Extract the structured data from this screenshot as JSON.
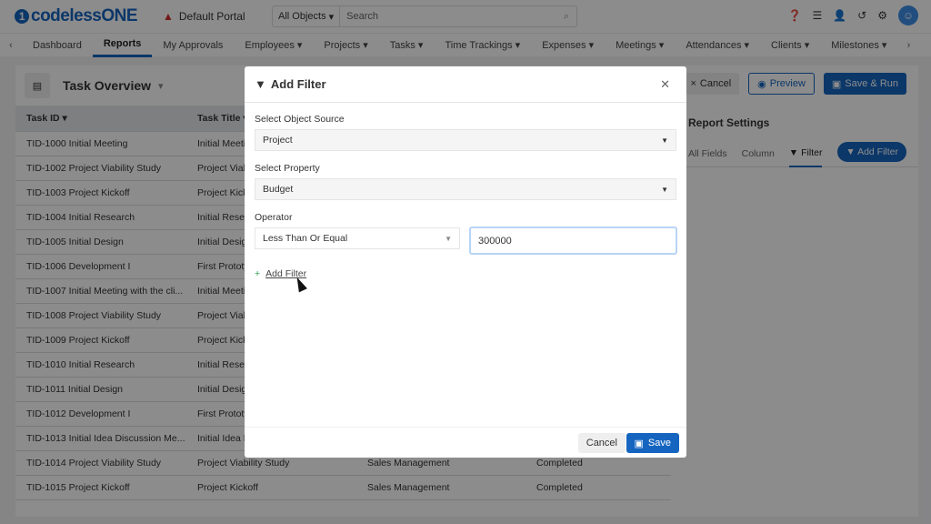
{
  "app": {
    "logo": "codelessONE",
    "portal": "Default Portal",
    "search_scope": "All Objects",
    "search_placeholder": "Search"
  },
  "nav": [
    "Dashboard",
    "Reports",
    "My Approvals",
    "Employees ▾",
    "Projects ▾",
    "Tasks ▾",
    "Time Trackings ▾",
    "Expenses ▾",
    "Meetings ▾",
    "Attendances ▾",
    "Clients ▾",
    "Milestones ▾"
  ],
  "report": {
    "title": "Task Overview",
    "cancel": "Cancel",
    "preview": "Preview",
    "save_run": "Save & Run"
  },
  "table": {
    "headers": [
      "Task ID ▾",
      "Task Title ▾",
      "",
      ""
    ],
    "rows": [
      [
        "TID-1000 Initial Meeting",
        "Initial Meeting",
        "",
        ""
      ],
      [
        "TID-1002 Project Viability Study",
        "Project Viability Study",
        "",
        ""
      ],
      [
        "TID-1003 Project Kickoff",
        "Project Kickoff",
        "",
        ""
      ],
      [
        "TID-1004 Initial Research",
        "Initial Research",
        "",
        ""
      ],
      [
        "TID-1005 Initial Design",
        "Initial Design",
        "",
        ""
      ],
      [
        "TID-1006 Development I",
        "First Prototype",
        "",
        ""
      ],
      [
        "TID-1007 Initial Meeting with the cli...",
        "Initial Meeting",
        "",
        ""
      ],
      [
        "TID-1008 Project Viability Study",
        "Project Viability Study",
        "",
        ""
      ],
      [
        "TID-1009 Project Kickoff",
        "Project Kickoff",
        "",
        ""
      ],
      [
        "TID-1010 Initial Research",
        "Initial Research",
        "",
        ""
      ],
      [
        "TID-1011 Initial Design",
        "Initial Design",
        "",
        ""
      ],
      [
        "TID-1012 Development I",
        "First Prototype",
        "",
        ""
      ],
      [
        "TID-1013 Initial Idea Discussion Me...",
        "Initial Idea Discussion",
        "",
        ""
      ],
      [
        "TID-1014 Project Viability Study",
        "Project Viability Study",
        "Sales Management",
        "Completed"
      ],
      [
        "TID-1015 Project Kickoff",
        "Project Kickoff",
        "Sales Management",
        "Completed"
      ]
    ]
  },
  "settings": {
    "title": "Report Settings",
    "tabs": [
      "All Fields",
      "Column",
      "Filter"
    ],
    "add_filter": "Add Filter"
  },
  "modal": {
    "title": "Add Filter",
    "source_label": "Select Object Source",
    "source": "Project",
    "property_label": "Select Property",
    "property": "Budget",
    "operator_label": "Operator",
    "operator": "Less Than Or Equal",
    "value": "300000",
    "add_filter": "Add Filter",
    "cancel": "Cancel",
    "save": "Save"
  }
}
